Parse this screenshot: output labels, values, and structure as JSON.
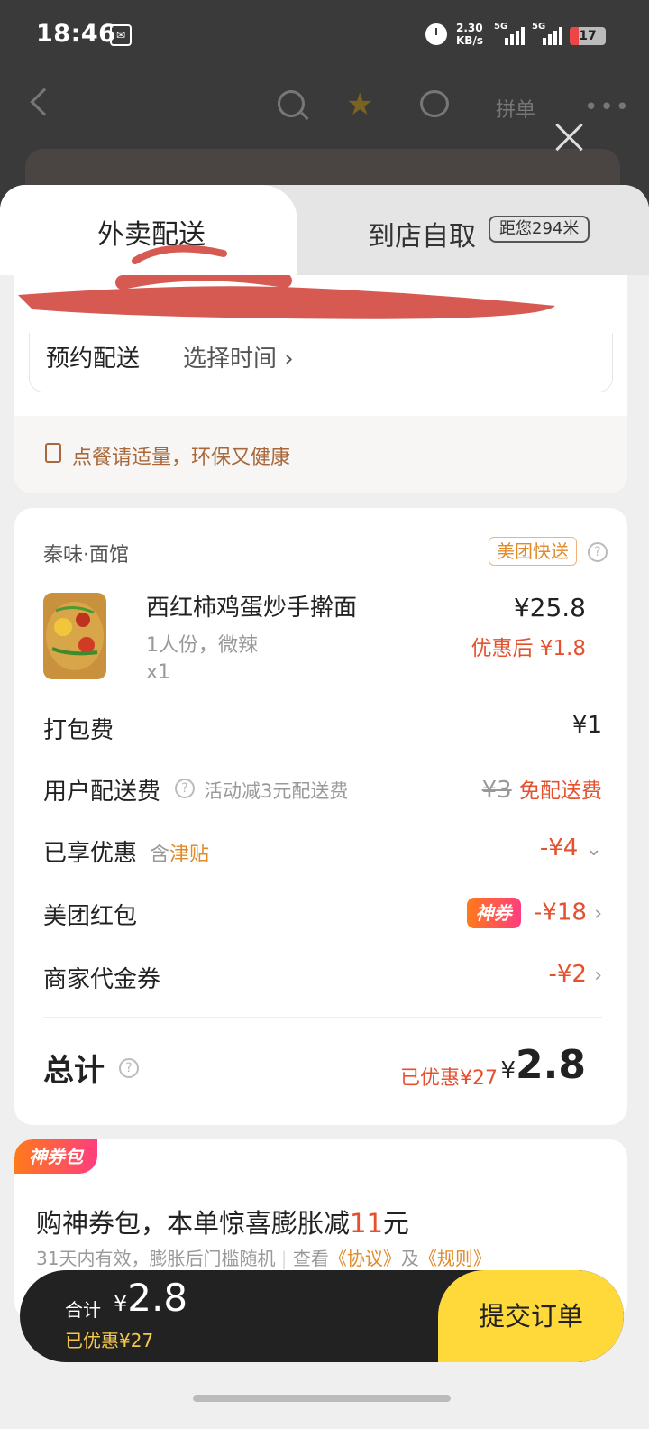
{
  "status_bar": {
    "time": "18:46",
    "net_speed": "2.30",
    "net_unit": "KB/s",
    "signal_1": "5G",
    "signal_2": "5G",
    "battery": "17"
  },
  "nav": {
    "pin_label": "拼单"
  },
  "tabs": {
    "delivery": "外卖配送",
    "pickup": "到店自取",
    "distance": "距您294米"
  },
  "address": {
    "reserve_label": "预约配送",
    "reserve_value": "选择时间 ›"
  },
  "tip": "点餐请适量，环保又健康",
  "order": {
    "shop_name": "秦味·面馆",
    "delivery_badge": "美团快送",
    "item": {
      "name": "西红柿鸡蛋炒手擀面",
      "spec": "1人份，微辣",
      "qty": "x1",
      "price": "¥25.8",
      "after_price": "优惠后 ¥1.8"
    },
    "rows": {
      "packing_label": "打包费",
      "packing_value": "¥1",
      "delivery_label": "用户配送费",
      "delivery_note": "活动减3元配送费",
      "delivery_orig": "¥3",
      "delivery_value": "免配送费",
      "discount_label": "已享优惠",
      "discount_note_prefix": "含",
      "discount_note_tag": "津贴",
      "discount_value": "-¥4",
      "redpack_label": "美团红包",
      "redpack_tag": "神券",
      "redpack_value": "-¥18",
      "voucher_label": "商家代金券",
      "voucher_value": "-¥2"
    },
    "total_label": "总计",
    "total_saved": "已优惠¥27",
    "total_currency": "¥",
    "total_value": "2.8"
  },
  "package": {
    "tag": "神券包",
    "title_prefix": "购神券包，本单惊喜膨胀减",
    "title_number": "11",
    "title_suffix": "元",
    "sub_text": "31天内有效，膨胀后门槛随机",
    "sub_view": "查看",
    "sub_agreement": "《协议》",
    "sub_and": "及",
    "sub_rules": "《规则》"
  },
  "paybar": {
    "label": "合计",
    "currency": "¥",
    "amount": "2.8",
    "saved": "已优惠¥27",
    "submit": "提交订单"
  },
  "colors": {
    "accent_red": "#e5502e",
    "accent_orange": "#e08a2a",
    "submit_yellow": "#ffd83a"
  }
}
